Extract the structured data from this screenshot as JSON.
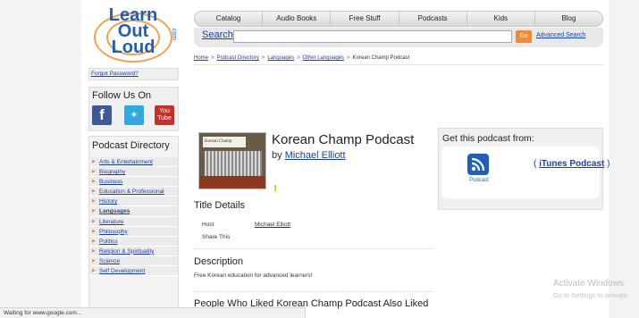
{
  "logo": {
    "line1": "Learn",
    "line2": "Out",
    "line3": "Loud",
    "dotcom": ".com"
  },
  "nav": {
    "tabs": [
      "Catalog",
      "Audio Books",
      "Free Stuff",
      "Podcasts",
      "Kids",
      "Blog"
    ]
  },
  "search": {
    "label": "Search",
    "value": "",
    "go_label": "Go",
    "advanced_label": "Advanced Search"
  },
  "breadcrumb": [
    "Home",
    "Podcast Directory",
    "Languages",
    "Other Languages",
    "Korean Champ Podcast"
  ],
  "sidebar": {
    "forgot_password": "Forgot Password?",
    "follow_title": "Follow Us On",
    "social": {
      "facebook": "f",
      "twitter": "✦",
      "youtube_top": "You",
      "youtube_bottom": "Tube"
    },
    "directory_title": "Podcast Directory",
    "directory_items": [
      "Arts & Entertainment",
      "Biography",
      "Business",
      "Education & Professional",
      "History",
      "Languages",
      "Literature",
      "Philosophy",
      "Politics",
      "Religion & Spirituality",
      "Science",
      "Self Development"
    ]
  },
  "podcast": {
    "cover_text": "Korean Champ",
    "title": "Korean Champ Podcast",
    "by_label": "by",
    "author": "Michael Elliott"
  },
  "get_podcast": {
    "title": "Get this podcast from:",
    "rss_label": "Podcast",
    "itunes_prefix": "(",
    "itunes_label": "iTunes Podcast",
    "itunes_suffix": ")"
  },
  "title_details": {
    "heading": "Title Details",
    "host_label": "Host",
    "host_value": "Michael Elliott",
    "share_label": "Share This"
  },
  "description": {
    "heading": "Description",
    "text": "Free Korean education for advanced learners!"
  },
  "also_liked": {
    "heading": "People Who Liked Korean Champ Podcast Also Liked"
  },
  "watermark": {
    "line1": "Activate Windows",
    "line2": "Go to Settings to activate"
  },
  "status_bar": {
    "text": "Waiting for www.google.com..."
  },
  "colors": {
    "accent_orange": "#f08a3a",
    "link_blue": "#1a3fb0",
    "logo_blue": "#1f5fb8",
    "facebook": "#3b5998",
    "twitter": "#2faae1",
    "youtube": "#c4302b"
  }
}
